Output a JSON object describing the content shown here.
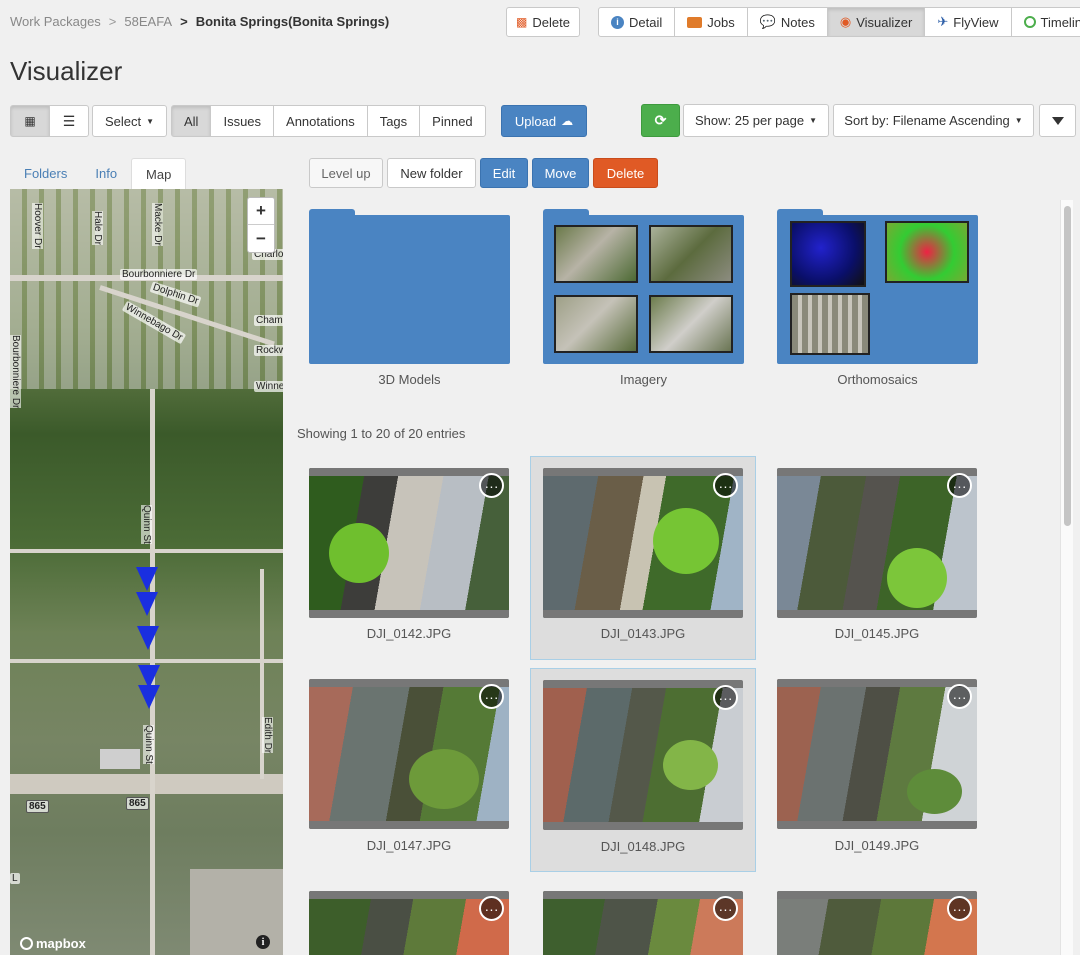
{
  "breadcrumb": {
    "root": "Work Packages",
    "sep1": ">",
    "mid": "58EAFA",
    "sep2": ">",
    "current": "Bonita Springs(Bonita Springs)"
  },
  "page_title": "Visualizer",
  "top_nav": {
    "delete": "Delete",
    "detail": "Detail",
    "jobs": "Jobs",
    "notes": "Notes",
    "visualizer": "Visualizer",
    "flyview": "FlyView",
    "timeline": "Timeline"
  },
  "toolbar": {
    "select": "Select",
    "filters": [
      "All",
      "Issues",
      "Annotations",
      "Tags",
      "Pinned"
    ],
    "upload": "Upload",
    "show": "Show: 25 per page",
    "sort": "Sort by: Filename Ascending"
  },
  "side_tabs": [
    "Folders",
    "Info",
    "Map"
  ],
  "map": {
    "zoom_in": "+",
    "zoom_out": "−",
    "streets": [
      "Hoover Dr",
      "Hale Dr",
      "Macke Dr",
      "Bourbonniere Dr",
      "Dolphin Dr",
      "Winnebago Dr",
      "Charlo",
      "Cham",
      "Rockw",
      "Winne",
      "Bourbonniere Dr",
      "Quinn St",
      "Quinn St",
      "Edith Dr",
      "865",
      "865",
      "L"
    ],
    "attribution": "mapbox",
    "info": "i"
  },
  "folder_actions": {
    "level_up": "Level up",
    "new_folder": "New folder",
    "edit": "Edit",
    "move": "Move",
    "delete": "Delete"
  },
  "folders": [
    {
      "name": "3D Models"
    },
    {
      "name": "Imagery"
    },
    {
      "name": "Orthomosaics"
    }
  ],
  "entries_text": "Showing 1 to 20 of 20 entries",
  "images": [
    {
      "name": "DJI_0142.JPG",
      "selected": false
    },
    {
      "name": "DJI_0143.JPG",
      "selected": true
    },
    {
      "name": "DJI_0145.JPG",
      "selected": false
    },
    {
      "name": "DJI_0147.JPG",
      "selected": false
    },
    {
      "name": "DJI_0148.JPG",
      "selected": true
    },
    {
      "name": "DJI_0149.JPG",
      "selected": false
    }
  ],
  "more_icon": "···",
  "colors": {
    "primary": "#4a84c2",
    "success": "#4cae4c",
    "danger": "#e05a25",
    "accent_link": "#4a7fb5"
  }
}
